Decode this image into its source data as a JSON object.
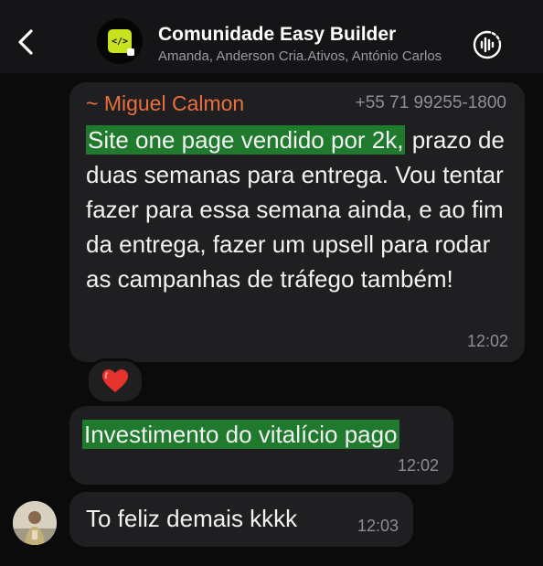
{
  "header": {
    "title": "Comunidade Easy Builder",
    "members": "Amanda, Anderson Cria.Ativos, António Carlos",
    "avatar_glyph": "</>",
    "icons": {
      "back": "chevron-left-icon",
      "audio": "waveform-icon"
    }
  },
  "messages": [
    {
      "sender": "~ Miguel Calmon",
      "phone": "+55 71 99255-1800",
      "highlight": "Site one page vendido por 2k,",
      "text": "prazo de duas semanas para entrega. Vou tentar fazer para essa semana ainda, e ao fim da entrega, fazer um upsell para rodar as campanhas de tráfego também!",
      "time": "12:02",
      "reaction": "❤️"
    },
    {
      "highlight": "Investimento do vitalício pago",
      "time": "12:02"
    },
    {
      "text": "To feliz demais kkkk",
      "time": "12:03"
    }
  ],
  "colors": {
    "background": "#0b0b0c",
    "header": "#151517",
    "bubble": "#1f1f22",
    "sender": "#e8703a",
    "highlight": "#1f7a2e",
    "avatar_tile": "#c9e21f"
  }
}
